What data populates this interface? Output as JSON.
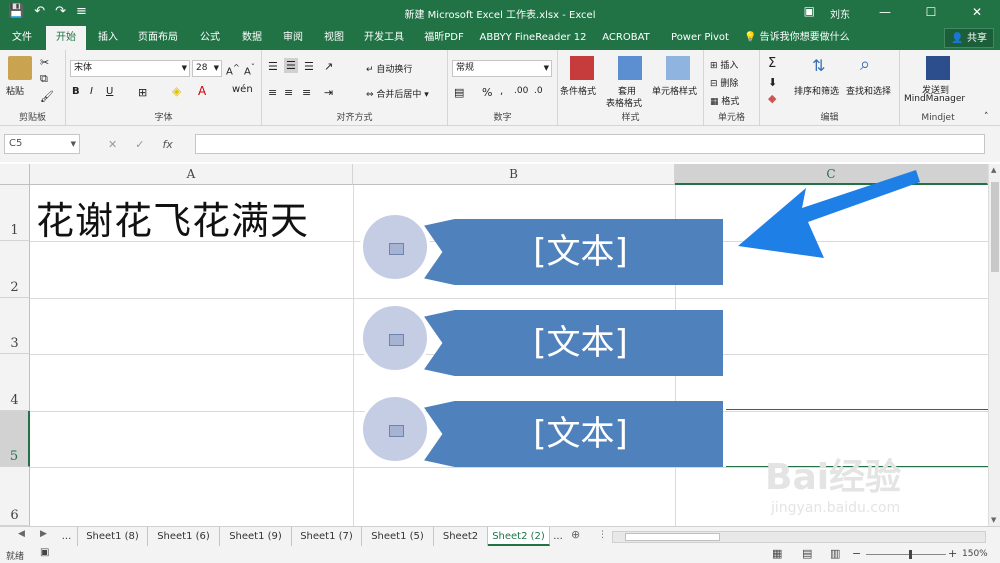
{
  "window": {
    "title": "新建 Microsoft Excel 工作表.xlsx  -  Excel",
    "user": "刘东"
  },
  "tabs": [
    {
      "label": "文件"
    },
    {
      "label": "开始"
    },
    {
      "label": "插入"
    },
    {
      "label": "页面布局"
    },
    {
      "label": "公式"
    },
    {
      "label": "数据"
    },
    {
      "label": "审阅"
    },
    {
      "label": "视图"
    },
    {
      "label": "开发工具"
    },
    {
      "label": "福昕PDF"
    },
    {
      "label": "ABBYY FineReader 12"
    },
    {
      "label": "ACROBAT"
    },
    {
      "label": "Power Pivot"
    }
  ],
  "tell_me": "告诉我你想要做什么",
  "share": "共享",
  "ribbon": {
    "clipboard": {
      "paste": "粘贴",
      "label": "剪贴板"
    },
    "font": {
      "name": "宋体",
      "size": "28",
      "label": "字体",
      "bold": "B",
      "italic": "I",
      "underline": "U"
    },
    "alignment": {
      "wrap": "自动换行",
      "merge": "合并后居中",
      "label": "对齐方式"
    },
    "number": {
      "format": "常规",
      "percent": "%",
      "label": "数字"
    },
    "styles": {
      "conditional": "条件格式",
      "table1": "套用",
      "table2": "表格格式",
      "cell": "单元格样式",
      "label": "样式"
    },
    "cells": {
      "insert": "插入",
      "delete": "删除",
      "format": "格式",
      "label": "单元格"
    },
    "editing": {
      "sort": "排序和筛选",
      "find": "查找和选择",
      "label": "编辑"
    },
    "mindjet": {
      "send1": "发送到",
      "send2": "MindManager",
      "label": "Mindjet"
    }
  },
  "formula_bar": {
    "name_box": "C5",
    "fx": "fx",
    "value": ""
  },
  "columns": [
    {
      "label": "A"
    },
    {
      "label": "B"
    },
    {
      "label": "C"
    }
  ],
  "rows": [
    "1",
    "2",
    "3",
    "4",
    "5",
    "6"
  ],
  "cells": {
    "A1": "花谢花飞花满天"
  },
  "smartart": [
    {
      "text": "[文本]"
    },
    {
      "text": "[文本]"
    },
    {
      "text": "[文本]"
    }
  ],
  "sheets": [
    {
      "label": "..."
    },
    {
      "label": "Sheet1 (8)"
    },
    {
      "label": "Sheet1 (6)"
    },
    {
      "label": "Sheet1 (9)"
    },
    {
      "label": "Sheet1 (7)"
    },
    {
      "label": "Sheet1 (5)"
    },
    {
      "label": "Sheet2"
    },
    {
      "label": "Sheet2 (2)"
    },
    {
      "label": "..."
    }
  ],
  "status": {
    "mode": "就绪",
    "zoom": "150%"
  },
  "watermark": {
    "brand": "Bai经验",
    "url": "jingyan.baidu.com"
  },
  "colors": {
    "excel_green": "#217346",
    "smartart_blue": "#4f81bd",
    "arrow_blue": "#1e7fe6"
  }
}
